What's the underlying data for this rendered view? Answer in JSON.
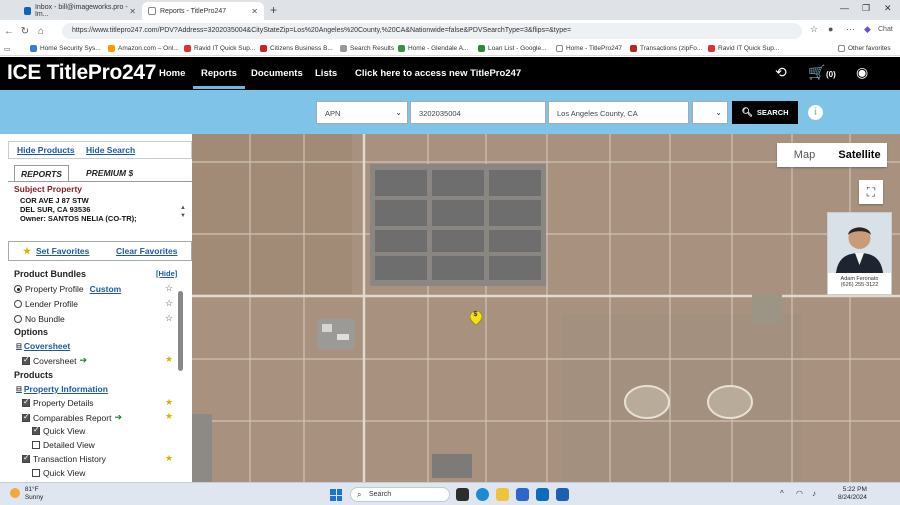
{
  "browser": {
    "tabs": [
      {
        "title": "Inbox - bill@imageworks.pro - Im..."
      },
      {
        "title": "Reports - TitlePro247"
      }
    ],
    "url": "https://www.titlepro247.com/PDV?Address=3202035004&CityStateZip=Los%20Angeles%20County,%20CA&Nationwide=false&PDVSearchType=3&flips=&type=",
    "chat_label": "Chat",
    "bookmarks": [
      "Home Security Sys...",
      "Amazon.com – Onl...",
      "Ravid IT Quick Sup...",
      "Citizens Business B...",
      "Search Results",
      "Home - Glendale A...",
      "Loan List - Google...",
      "Home - TitlePro247",
      "Transactions (zipFo...",
      "Ravid IT Quick Sup...",
      "Other favorites"
    ]
  },
  "app": {
    "brand": "ICE TitlePro247",
    "nav": {
      "home": "Home",
      "reports": "Reports",
      "documents": "Documents",
      "lists": "Lists",
      "promo": "Click here to access new TitlePro247"
    },
    "cart_count": "(0)",
    "accent": "#7fc3e8"
  },
  "search": {
    "type": "APN",
    "value": "3202035004",
    "location": "Los Angeles County, CA",
    "button": "SEARCH",
    "info": "i"
  },
  "map": {
    "toggle_map": "Map",
    "toggle_satellite": "Satellite",
    "selected": "Satellite",
    "pin_label": "$"
  },
  "agent": {
    "name": "Adam Feronato",
    "phone": "(626) 255-3122"
  },
  "sidebar": {
    "hide_products": "Hide Products",
    "hide_search": "Hide Search",
    "tab_reports": "REPORTS",
    "tab_premium": "PREMIUM $",
    "subject_heading": "Subject Property",
    "subject_line1": "COR AVE J 87 STW",
    "subject_line2": "DEL SUR, CA 93536",
    "subject_line3": "Owner: SANTOS NELIA (CO-TR);",
    "set_favorites": "Set Favorites",
    "clear_favorites": "Clear Favorites",
    "product_bundles": "Product Bundles",
    "hide": "[Hide]",
    "property_profile": "Property Profile",
    "custom": "Custom",
    "lender_profile": "Lender Profile",
    "no_bundle": "No Bundle",
    "options": "Options",
    "coversheet_group": "Coversheet",
    "coversheet": "Coversheet",
    "products": "Products",
    "property_information": "Property Information",
    "property_details": "Property Details",
    "comparables_report": "Comparables Report",
    "quick_view": "Quick View",
    "detailed_view": "Detailed View",
    "transaction_history": "Transaction History",
    "quick_view_2": "Quick View"
  },
  "taskbar": {
    "temp": "81°F",
    "condition": "Sunny",
    "search": "Search",
    "time": "5:22 PM",
    "date": "8/24/2024"
  }
}
